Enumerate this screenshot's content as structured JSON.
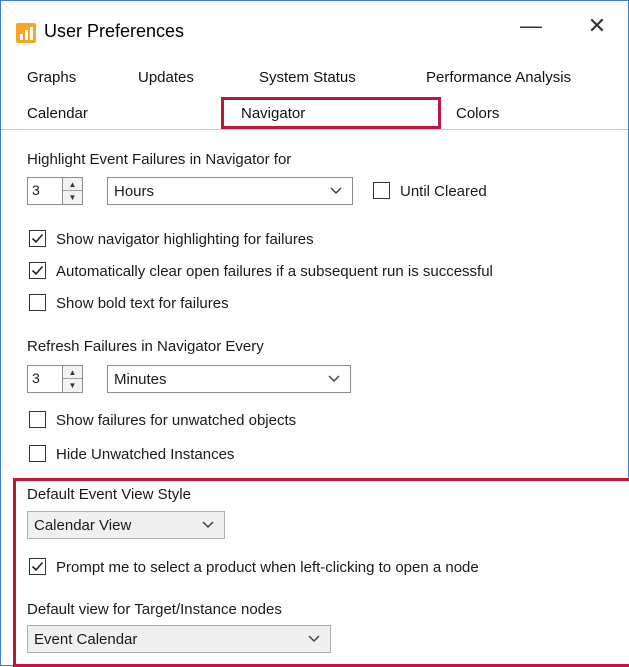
{
  "window": {
    "title": "User Preferences",
    "minimize_glyph": "—",
    "close_glyph": "✕"
  },
  "tabs": [
    {
      "label": "Graphs"
    },
    {
      "label": "Updates"
    },
    {
      "label": "System Status"
    },
    {
      "label": "Performance Analysis"
    },
    {
      "label": "Calendar"
    },
    {
      "label": "Navigator",
      "selected": true
    },
    {
      "label": "Colors"
    }
  ],
  "highlight": {
    "label": "Highlight Event Failures in Navigator for",
    "value": "3",
    "unit": "Hours",
    "until_cleared_label": "Until Cleared",
    "until_cleared": false
  },
  "options": [
    {
      "label": "Show navigator highlighting for failures",
      "checked": true
    },
    {
      "label": "Automatically clear open failures if a subsequent run is successful",
      "checked": true
    },
    {
      "label": "Show bold text for failures",
      "checked": false
    }
  ],
  "refresh": {
    "label": "Refresh Failures in Navigator Every",
    "value": "3",
    "unit": "Minutes"
  },
  "unwatched": [
    {
      "label": "Show failures for unwatched objects",
      "checked": false
    },
    {
      "label": "Hide Unwatched Instances",
      "checked": false
    }
  ],
  "event_view": {
    "label": "Default Event View Style",
    "value": "Calendar View"
  },
  "prompt": {
    "label": "Prompt me to select a product when left-clicking to open a node",
    "checked": true
  },
  "target_view": {
    "label": "Default view for Target/Instance nodes",
    "value": "Event Calendar"
  },
  "colors": {
    "accent_red": "#c0163e",
    "app_icon": "#f5a623"
  }
}
